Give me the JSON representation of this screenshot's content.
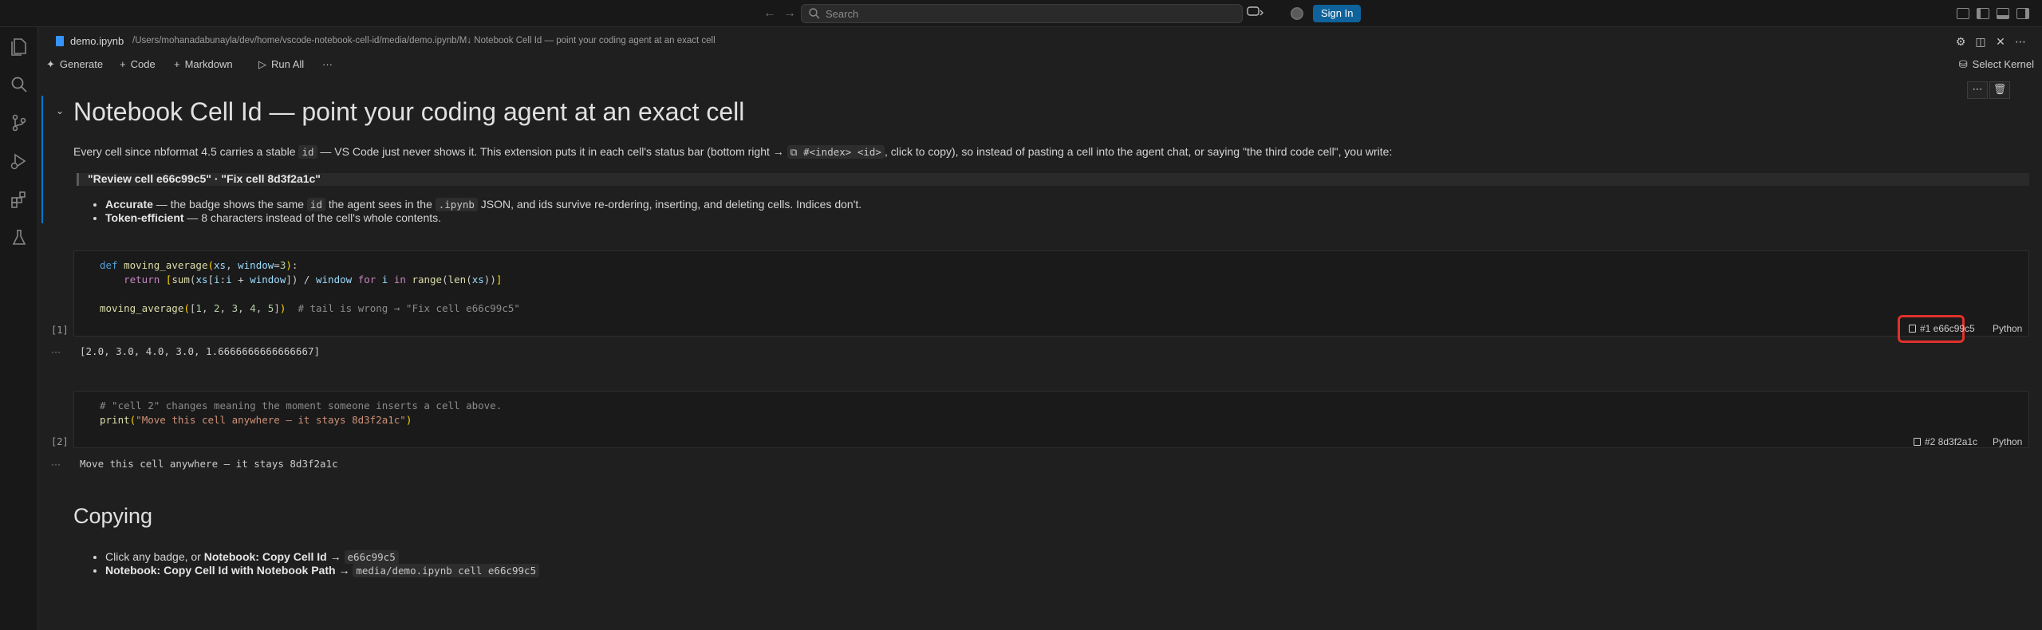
{
  "titlebar": {
    "search_placeholder": "Search",
    "signin_label": "Sign In"
  },
  "activity_bar": {
    "icons": [
      "files-icon",
      "search-icon",
      "source-control-icon",
      "run-debug-icon",
      "extensions-icon",
      "testing-icon"
    ]
  },
  "editor": {
    "file_name": "demo.ipynb",
    "breadcrumb_path": "/Users/mohanadabunayla/dev/home/vscode-notebook-cell-id/media/demo.ipynb/M↓ Notebook Cell Id — point your coding agent at an exact cell"
  },
  "notebook_toolbar": {
    "generate": "Generate",
    "code": "Code",
    "markdown": "Markdown",
    "run_all": "Run All",
    "more": "···",
    "select_kernel": "Select Kernel"
  },
  "markdown_cell_1": {
    "heading": "Notebook Cell Id — point your coding agent at an exact cell",
    "para_1": "Every cell since nbformat 4.5 carries a stable ",
    "para_code_1": "id",
    "para_2": " — VS Code just never shows it. This extension puts it in each cell's status bar (bottom right → ",
    "para_code_2": "⧉ #<index> <id>",
    "para_3": ", click to copy), so instead of pasting a cell into the agent chat, or saying \"the third code cell\", you write:",
    "quote": "\"Review cell e66c99c5\" · \"Fix cell 8d3f2a1c\"",
    "bullet_1_bold": "Accurate",
    "bullet_1_text_a": " — the badge shows the same ",
    "bullet_1_code_a": "id",
    "bullet_1_text_b": " the agent sees in the ",
    "bullet_1_code_b": ".ipynb",
    "bullet_1_text_c": " JSON, and ids survive re-ordering, inserting, and deleting cells. Indices don't.",
    "bullet_2_bold": "Token-efficient",
    "bullet_2_text": " — 8 characters instead of the cell's whole contents."
  },
  "code_cell_1": {
    "exec_count": "[1]",
    "output": "[2.0, 3.0, 4.0, 3.0, 1.6666666666666667]",
    "badge": "#1 e66c99c5",
    "language": "Python",
    "comment": "# tail is wrong → \"Fix cell e66c99c5\""
  },
  "code_cell_2": {
    "exec_count": "[2]",
    "comment": "# \"cell 2\" changes meaning the moment someone inserts a cell above.",
    "string": "\"Move this cell anywhere — it stays 8d3f2a1c\"",
    "output": "Move this cell anywhere — it stays 8d3f2a1c",
    "badge": "#2 8d3f2a1c",
    "language": "Python"
  },
  "output_dots": "···",
  "markdown_cell_2": {
    "heading": "Copying",
    "bullet_1_text": "Click any badge, or ",
    "bullet_1_bold": "Notebook: Copy Cell Id →",
    "bullet_1_code": "e66c99c5",
    "bullet_2_bold": "Notebook: Copy Cell Id with Notebook Path →",
    "bullet_2_code": "media/demo.ipynb cell e66c99c5"
  },
  "colors": {
    "accent": "#007acc",
    "signin": "#0e639c",
    "highlight": "#e0312b"
  }
}
